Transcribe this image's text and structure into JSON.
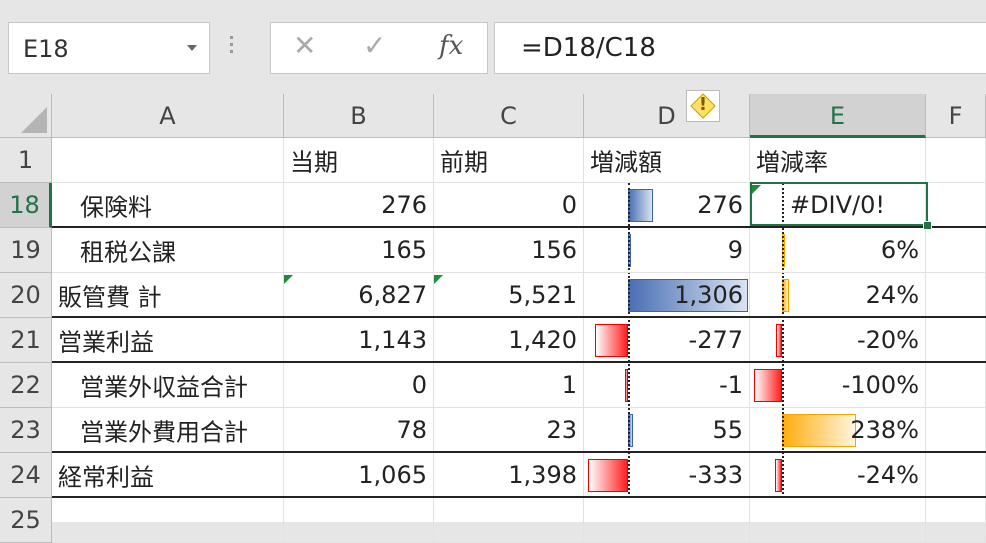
{
  "name_box": {
    "value": "E18"
  },
  "formula_bar": {
    "cancel": "✕",
    "enter": "✓",
    "fx": "fx",
    "formula": "=D18/C18"
  },
  "columns": [
    "A",
    "B",
    "C",
    "D",
    "E",
    "F"
  ],
  "header_row": {
    "row": "1",
    "A": "",
    "B": "当期",
    "C": "前期",
    "D": "増減額",
    "E": "増減率"
  },
  "rows": [
    {
      "row": "18",
      "A": "保険料",
      "B": "276",
      "C": "0",
      "D": "276",
      "E": "#DIV/0!"
    },
    {
      "row": "19",
      "A": "租税公課",
      "B": "165",
      "C": "156",
      "D": "9",
      "E": "6%"
    },
    {
      "row": "20",
      "A": "販管費 計",
      "B": "6,827",
      "C": "5,521",
      "D": "1,306",
      "E": "24%"
    },
    {
      "row": "21",
      "A": "営業利益",
      "B": "1,143",
      "C": "1,420",
      "D": "-277",
      "E": "-20%"
    },
    {
      "row": "22",
      "A": "営業外収益合計",
      "B": "0",
      "C": "1",
      "D": "-1",
      "E": "-100%"
    },
    {
      "row": "23",
      "A": "営業外費用合計",
      "B": "78",
      "C": "23",
      "D": "55",
      "E": "238%"
    },
    {
      "row": "24",
      "A": "経常利益",
      "B": "1,065",
      "C": "1,398",
      "D": "-333",
      "E": "-24%"
    },
    {
      "row": "25",
      "A": "",
      "B": "",
      "C": "",
      "D": "",
      "E": ""
    }
  ],
  "data_bars": {
    "D": {
      "color": "#4a6fb3",
      "negative_color": "#ff1e1e",
      "axis_value": 0,
      "min": -333,
      "max": 1306
    },
    "E": {
      "color": "#ffad0f",
      "negative_color": "#ff1e1e",
      "axis_value": 0,
      "min": -1.0,
      "max": 2.38
    }
  },
  "warning_icon": "warning-diamond-icon",
  "accent_color": "#217346"
}
